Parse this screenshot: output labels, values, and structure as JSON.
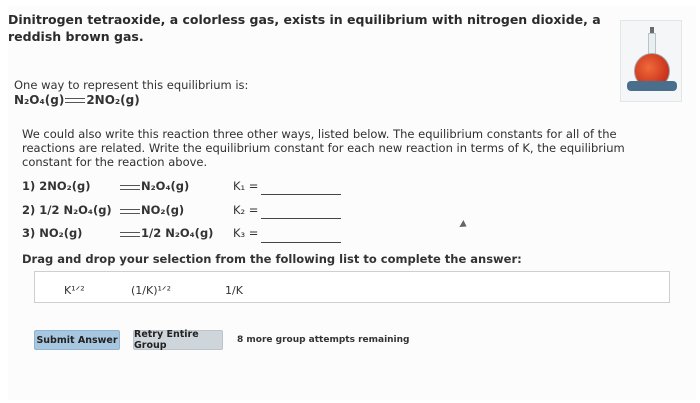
{
  "intro": "Dinitrogen tetraoxide, a colorless gas, exists in equilibrium with nitrogen dioxide, a reddish brown gas.",
  "representation": {
    "lead": "One way to represent this equilibrium is:",
    "lhs": "N₂O₄(g)",
    "rhs": "2NO₂(g)"
  },
  "paragraph": "We could also write this reaction three other ways, listed below. The equilibrium constants for all of the reactions are related. Write the equilibrium constant for each new reaction in terms of K, the equilibrium constant for the reaction above.",
  "reactions": [
    {
      "lhs": "1) 2NO₂(g)",
      "rhs": "N₂O₄(g)",
      "k_label": "K₁ ="
    },
    {
      "lhs": "2) 1/2 N₂O₄(g)",
      "rhs": "NO₂(g)",
      "k_label": "K₂ ="
    },
    {
      "lhs": "3) NO₂(g)",
      "rhs": "1/2 N₂O₄(g)",
      "k_label": "K₃ ="
    }
  ],
  "drag_title": "Drag and drop your selection from the following list to complete the answer:",
  "choices": [
    "K¹ᐟ²",
    "(1/K)¹ᐟ²",
    "1/K"
  ],
  "buttons": {
    "submit": "Submit Answer",
    "retry": "Retry Entire Group"
  },
  "attempts_text": "8 more group attempts remaining",
  "icons": {
    "flask": "flask-icon"
  }
}
